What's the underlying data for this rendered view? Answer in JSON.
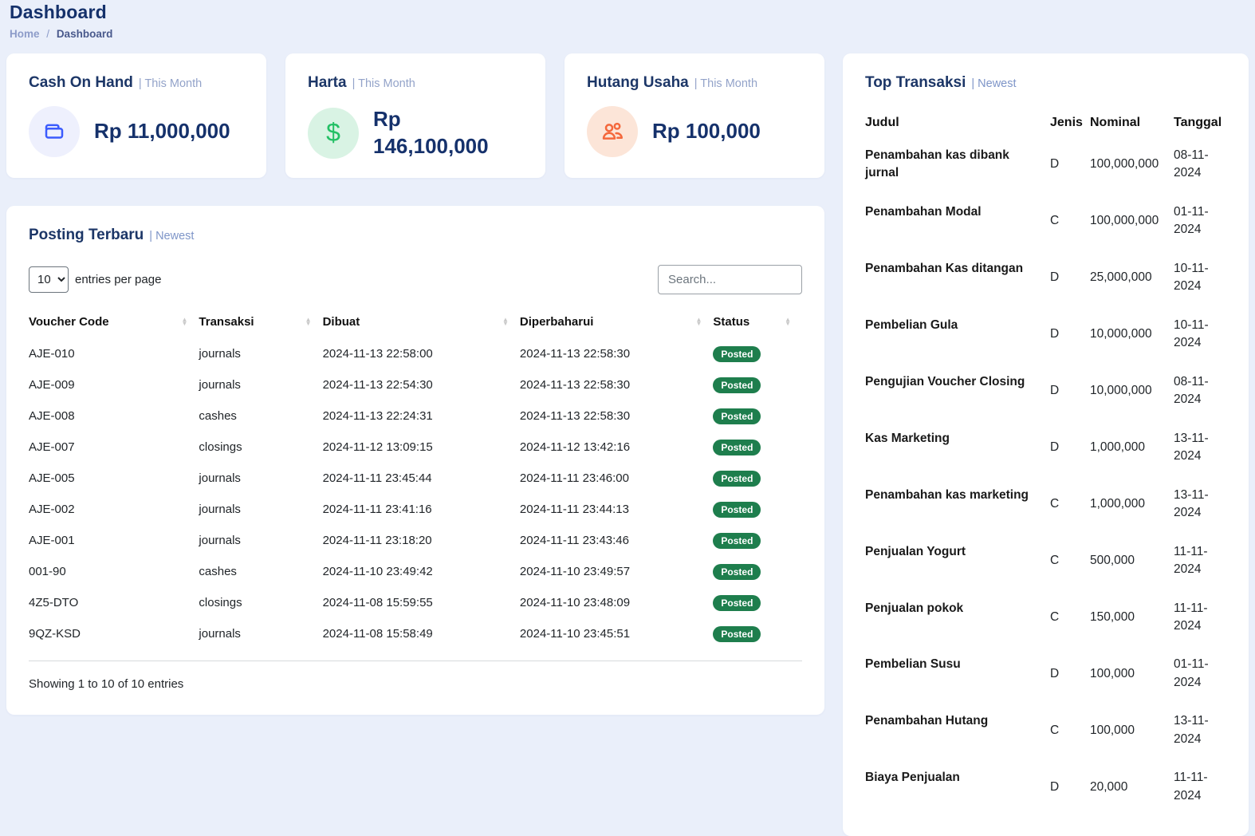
{
  "page": {
    "title": "Dashboard",
    "breadcrumb": {
      "home": "Home",
      "separator": "/",
      "current": "Dashboard"
    }
  },
  "cards": [
    {
      "title": "Cash On Hand",
      "subtitle": "| This Month",
      "amount": "Rp 11,000,000",
      "icon": "wallet-icon",
      "accent": "#3b5bfd",
      "icon_bg": "#eef0fd"
    },
    {
      "title": "Harta",
      "subtitle": "| This Month",
      "amount": "Rp 146,100,000",
      "icon": "dollar-icon",
      "accent": "#23c065",
      "icon_bg": "#d9f3e4"
    },
    {
      "title": "Hutang Usaha",
      "subtitle": "| This Month",
      "amount": "Rp 100,000",
      "icon": "users-icon",
      "accent": "#f4683c",
      "icon_bg": "#fce5d8"
    }
  ],
  "posting": {
    "title": "Posting Terbaru",
    "subtitle": "| Newest",
    "entries_per_page": {
      "value": "10",
      "label": "entries per page"
    },
    "search": {
      "placeholder": "Search..."
    },
    "columns": [
      "Voucher Code",
      "Transaksi",
      "Dibuat",
      "Diperbaharui",
      "Status"
    ],
    "rows": [
      {
        "code": "AJE-010",
        "type": "journals",
        "created": "2024-11-13 22:58:00",
        "updated": "2024-11-13 22:58:30",
        "status": "Posted"
      },
      {
        "code": "AJE-009",
        "type": "journals",
        "created": "2024-11-13 22:54:30",
        "updated": "2024-11-13 22:58:30",
        "status": "Posted"
      },
      {
        "code": "AJE-008",
        "type": "cashes",
        "created": "2024-11-13 22:24:31",
        "updated": "2024-11-13 22:58:30",
        "status": "Posted"
      },
      {
        "code": "AJE-007",
        "type": "closings",
        "created": "2024-11-12 13:09:15",
        "updated": "2024-11-12 13:42:16",
        "status": "Posted"
      },
      {
        "code": "AJE-005",
        "type": "journals",
        "created": "2024-11-11 23:45:44",
        "updated": "2024-11-11 23:46:00",
        "status": "Posted"
      },
      {
        "code": "AJE-002",
        "type": "journals",
        "created": "2024-11-11 23:41:16",
        "updated": "2024-11-11 23:44:13",
        "status": "Posted"
      },
      {
        "code": "AJE-001",
        "type": "journals",
        "created": "2024-11-11 23:18:20",
        "updated": "2024-11-11 23:43:46",
        "status": "Posted"
      },
      {
        "code": "001-90",
        "type": "cashes",
        "created": "2024-11-10 23:49:42",
        "updated": "2024-11-10 23:49:57",
        "status": "Posted"
      },
      {
        "code": "4Z5-DTO",
        "type": "closings",
        "created": "2024-11-08 15:59:55",
        "updated": "2024-11-10 23:48:09",
        "status": "Posted"
      },
      {
        "code": "9QZ-KSD",
        "type": "journals",
        "created": "2024-11-08 15:58:49",
        "updated": "2024-11-10 23:45:51",
        "status": "Posted"
      }
    ],
    "footer": "Showing 1 to 10 of 10 entries"
  },
  "top_transaksi": {
    "title": "Top Transaksi",
    "subtitle": "| Newest",
    "columns": [
      "Judul",
      "Jenis",
      "Nominal",
      "Tanggal"
    ],
    "rows": [
      {
        "judul": "Penambahan kas dibank jurnal",
        "jenis": "D",
        "nominal": "100,000,000",
        "tanggal": "08-11-2024"
      },
      {
        "judul": "Penambahan Modal",
        "jenis": "C",
        "nominal": "100,000,000",
        "tanggal": "01-11-2024"
      },
      {
        "judul": "Penambahan Kas ditangan",
        "jenis": "D",
        "nominal": "25,000,000",
        "tanggal": "10-11-2024"
      },
      {
        "judul": "Pembelian Gula",
        "jenis": "D",
        "nominal": "10,000,000",
        "tanggal": "10-11-2024"
      },
      {
        "judul": "Pengujian Voucher Closing",
        "jenis": "D",
        "nominal": "10,000,000",
        "tanggal": "08-11-2024"
      },
      {
        "judul": "Kas Marketing",
        "jenis": "D",
        "nominal": "1,000,000",
        "tanggal": "13-11-2024"
      },
      {
        "judul": "Penambahan kas marketing",
        "jenis": "C",
        "nominal": "1,000,000",
        "tanggal": "13-11-2024"
      },
      {
        "judul": "Penjualan Yogurt",
        "jenis": "C",
        "nominal": "500,000",
        "tanggal": "11-11-2024"
      },
      {
        "judul": "Penjualan pokok",
        "jenis": "C",
        "nominal": "150,000",
        "tanggal": "11-11-2024"
      },
      {
        "judul": "Pembelian Susu",
        "jenis": "D",
        "nominal": "100,000",
        "tanggal": "01-11-2024"
      },
      {
        "judul": "Penambahan Hutang",
        "jenis": "C",
        "nominal": "100,000",
        "tanggal": "13-11-2024"
      },
      {
        "judul": "Biaya Penjualan",
        "jenis": "D",
        "nominal": "20,000",
        "tanggal": "11-11-2024"
      }
    ]
  }
}
